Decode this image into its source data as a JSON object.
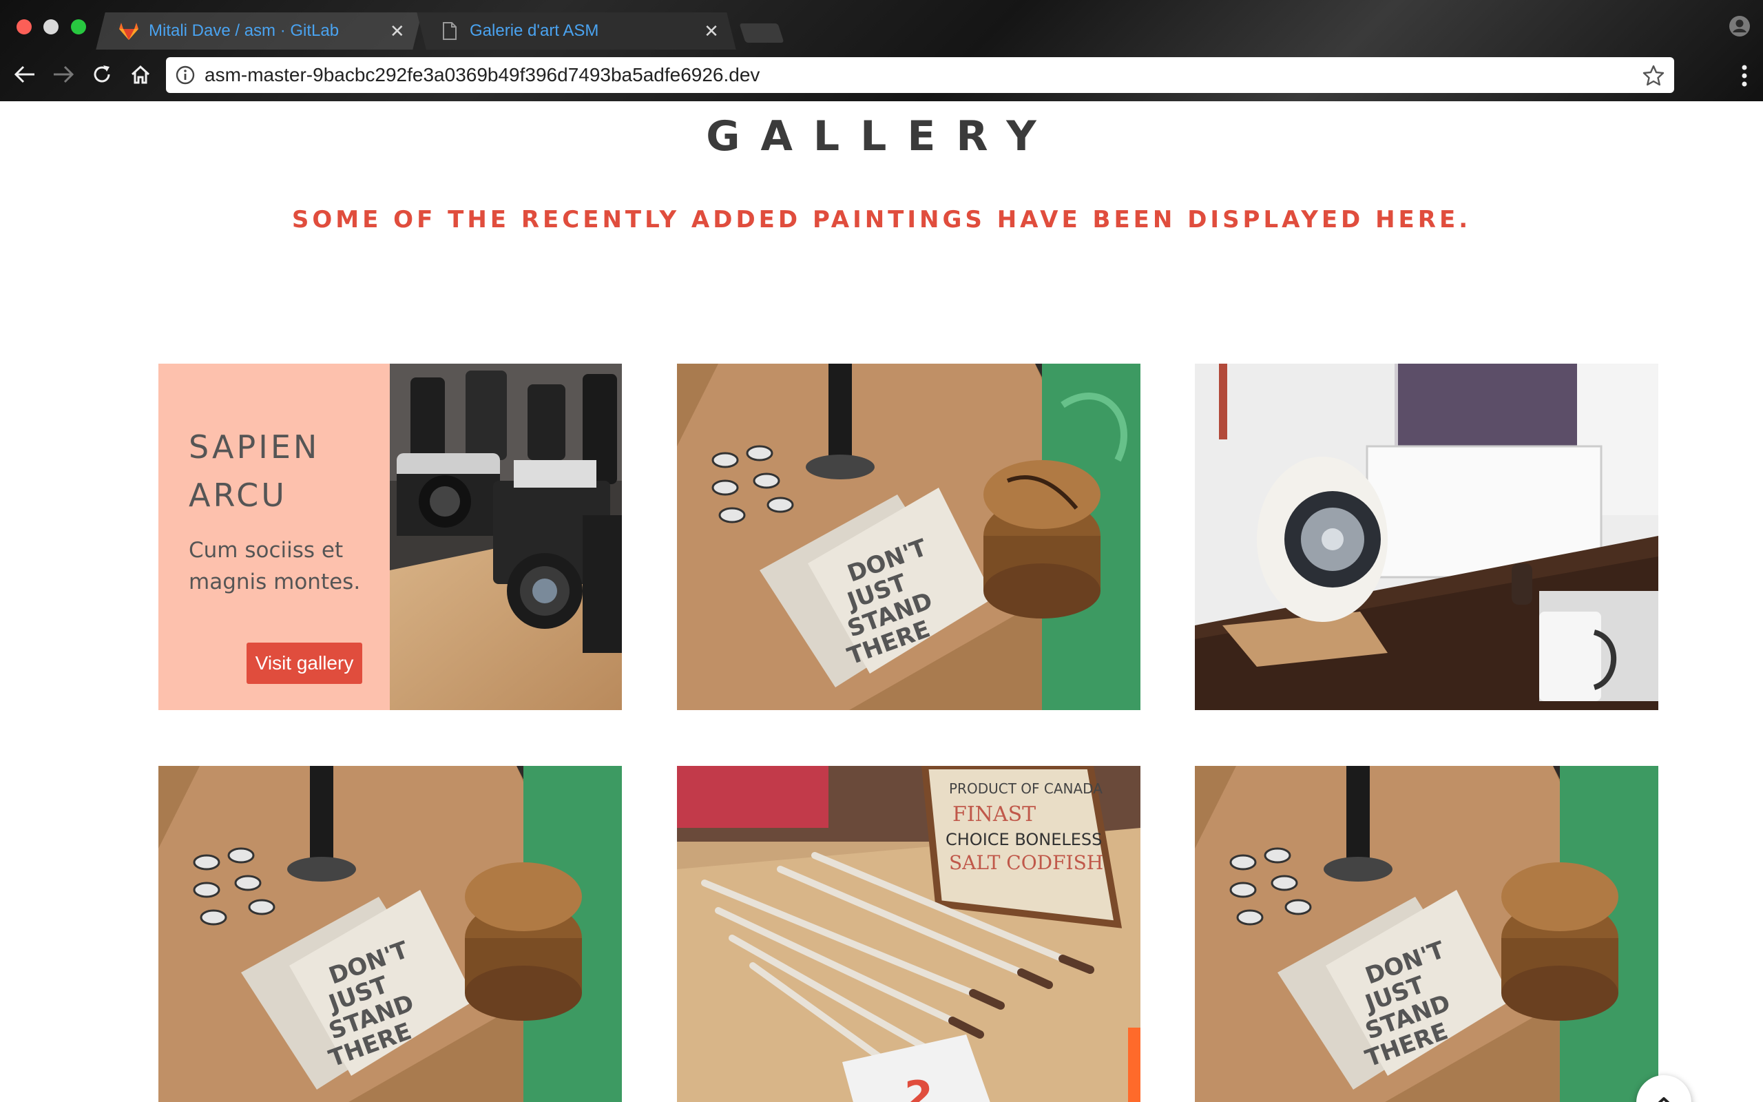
{
  "browser": {
    "tabs": [
      {
        "title": "Mitali Dave / asm · GitLab",
        "icon": "gitlab-icon",
        "active": false
      },
      {
        "title": "Galerie d'art ASM",
        "icon": "document-icon",
        "active": true
      }
    ],
    "url": "asm-master-9bacbc292fe3a0369b49f396d7493ba5adfe6926.dev"
  },
  "page": {
    "title": "GALLERY",
    "subtitle": "SOME OF THE RECENTLY ADDED PAINTINGS HAVE BEEN DISPLAYED HERE.",
    "featured": {
      "title": "SAPIEN ARCU",
      "text": "Cum sociiss et magnis montes.",
      "button": "Visit gallery"
    },
    "photos": [
      {
        "subject": "vintage cameras on wooden desk"
      },
      {
        "subject": "notebooks 'Don't just stand there' and coasters"
      },
      {
        "subject": "white speaker and desktop workspace"
      },
      {
        "subject": "notebooks 'Don't just stand there' and coasters"
      },
      {
        "subject": "paint brushes and wooden box"
      },
      {
        "subject": "notebooks 'Don't just stand there' and coasters"
      }
    ]
  },
  "colors": {
    "accent": "#e04d3d",
    "featured_bg": "#fdc1ad",
    "title_text": "#3b3b3b",
    "tab_link": "#4aa3f0"
  }
}
